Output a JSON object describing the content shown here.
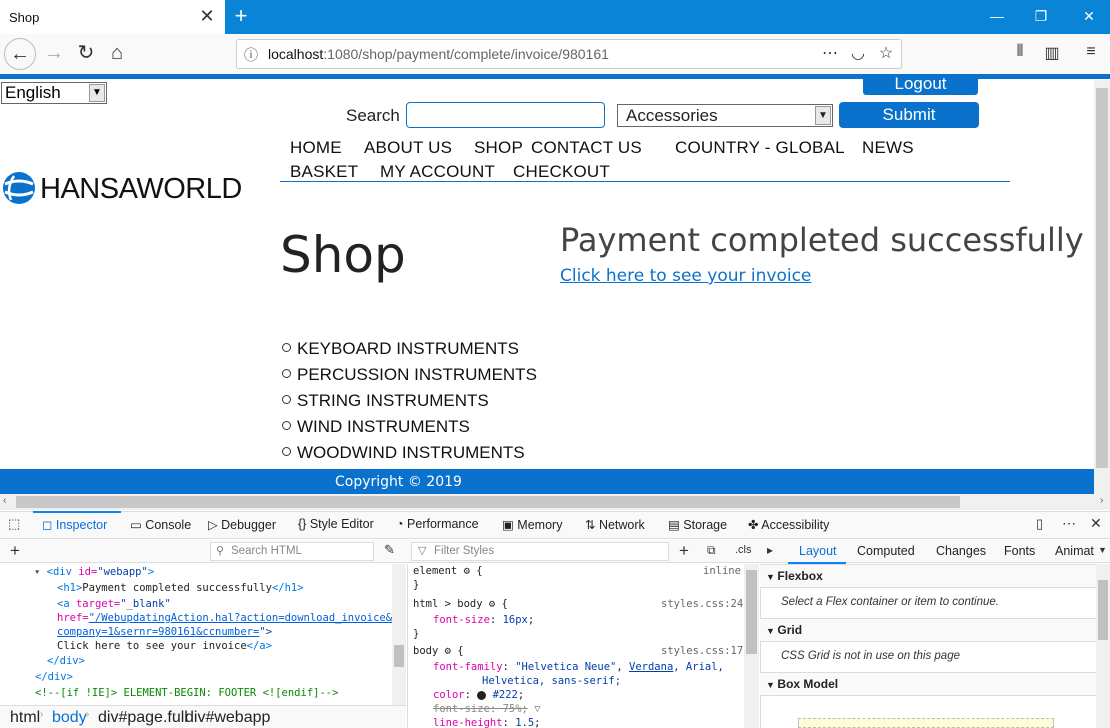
{
  "browser": {
    "tab_title": "Shop",
    "tab_close": "✕",
    "new_tab": "+",
    "url_host": "localhost",
    "url_path": ":1080/shop/payment/complete/invoice/980161",
    "window_controls": [
      "—",
      "❐",
      "✕"
    ]
  },
  "page": {
    "language": "English",
    "logout": "Logout",
    "search_label": "Search",
    "search_value": "",
    "category": "Accessories",
    "submit": "Submit",
    "menu": [
      "HOME",
      "ABOUT US",
      "SHOP",
      "CONTACT US",
      "COUNTRY - GLOBAL",
      "NEWS",
      "BASKET",
      "MY ACCOUNT",
      "CHECKOUT"
    ],
    "logo_text": "HANSAWORLD",
    "shop_title": "Shop",
    "payment_title": "Payment completed successfully",
    "invoice_link": "Click here to see your invoice",
    "categories": [
      "KEYBOARD INSTRUMENTS",
      "PERCUSSION INSTRUMENTS",
      "STRING INSTRUMENTS",
      "WIND INSTRUMENTS",
      "WOODWIND INSTRUMENTS"
    ],
    "footer": "Copyright © 2019"
  },
  "devtools": {
    "tabs": [
      "Inspector",
      "Console",
      "Debugger",
      "Style Editor",
      "Performance",
      "Memory",
      "Network",
      "Storage",
      "Accessibility"
    ],
    "search_html_placeholder": "Search HTML",
    "filter_styles_placeholder": "Filter Styles",
    "cls": ".cls",
    "layout_tabs": [
      "Layout",
      "Computed",
      "Changes",
      "Fonts",
      "Animat"
    ],
    "html": {
      "l1_tag": "<div",
      "l1_attr": " id=",
      "l1_val": "\"webapp\"",
      "l1_end": ">",
      "l2": "<h1>",
      "l2_text": "Payment completed successfully",
      "l2_end": "</h1>",
      "l3_tag": "<a",
      "l3_attr": " target=",
      "l3_val": "\"_blank\"",
      "l4_attr": "href=",
      "l4_val": "\"/WebupdatingAction.hal?action=download_invoice&",
      "l5_val": "company=1&sernr=980161&ccnumber=",
      "l5_end": "\">",
      "l6_text": "Click here to see your invoice",
      "l6_end": "</a>",
      "l7": "</div>",
      "l8": "</div>",
      "l9": "<!--[if !IE]> ELEMENT-BEGIN: FOOTER <![endif]-->"
    },
    "breadcrumbs": [
      "html",
      "body",
      "div#page.full",
      "div#webapp"
    ],
    "rules": {
      "r1_sel": "element",
      "r1_src": "inline",
      "r2_sel": "html > body",
      "r2_src": "styles.css:24",
      "r2_prop": "font-size",
      "r2_val": "16px",
      "r3_sel": "body",
      "r3_src": "styles.css:17",
      "r3_ff_prop": "font-family",
      "r3_ff_val1": "\"Helvetica Neue\"",
      "r3_ff_val2": "Verdana",
      "r3_ff_val3": ", Arial,",
      "r3_ff_val4": "Helvetica, sans-serif;",
      "r3_color_prop": "color",
      "r3_color_val": "#222",
      "r3_fs_prop": "font-size",
      "r3_fs_val": "75%",
      "r3_lh_prop": "line-height",
      "r3_lh_val": "1.5"
    },
    "layout": {
      "flexbox": "Flexbox",
      "flexbox_note": "Select a Flex container or item to continue.",
      "grid": "Grid",
      "grid_note": "CSS Grid is not in use on this page",
      "boxmodel": "Box Model"
    }
  }
}
